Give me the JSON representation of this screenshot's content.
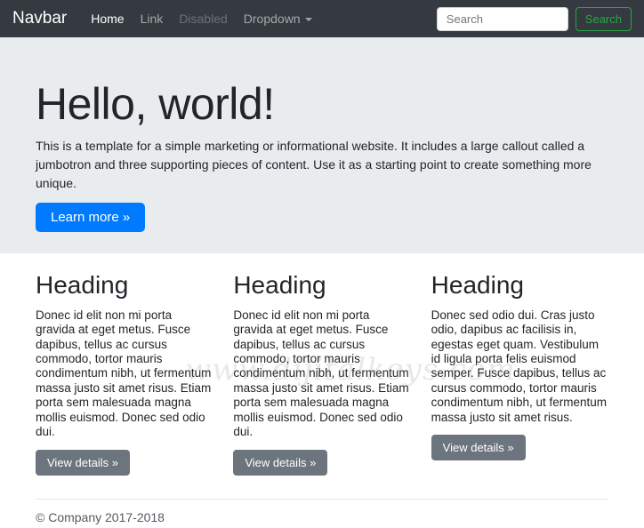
{
  "navbar": {
    "brand": "Navbar",
    "items": [
      {
        "label": "Home",
        "state": "active"
      },
      {
        "label": "Link",
        "state": "normal"
      },
      {
        "label": "Disabled",
        "state": "disabled"
      },
      {
        "label": "Dropdown",
        "state": "dropdown"
      }
    ],
    "search": {
      "placeholder": "Search",
      "value": "",
      "button_label": "Search"
    }
  },
  "jumbotron": {
    "title": "Hello, world!",
    "description": "This is a template for a simple marketing or informational website. It includes a large callout called a jumbotron and three supporting pieces of content. Use it as a starting point to create something more unique.",
    "cta_label": "Learn more »"
  },
  "columns": [
    {
      "heading": "Heading",
      "text": "Donec id elit non mi porta gravida at eget metus. Fusce dapibus, tellus ac cursus commodo, tortor mauris condimentum nibh, ut fermentum massa justo sit amet risus. Etiam porta sem malesuada magna mollis euismod. Donec sed odio dui.",
      "button_label": "View details »"
    },
    {
      "heading": "Heading",
      "text": "Donec id elit non mi porta gravida at eget metus. Fusce dapibus, tellus ac cursus commodo, tortor mauris condimentum nibh, ut fermentum massa justo sit amet risus. Etiam porta sem malesuada magna mollis euismod. Donec sed odio dui.",
      "button_label": "View details »"
    },
    {
      "heading": "Heading",
      "text": "Donec sed odio dui. Cras justo odio, dapibus ac facilisis in, egestas eget quam. Vestibulum id ligula porta felis euismod semper. Fusce dapibus, tellus ac cursus commodo, tortor mauris condimentum nibh, ut fermentum massa justo sit amet risus.",
      "button_label": "View details »"
    }
  ],
  "footer": {
    "copyright": "© Company 2017-2018"
  },
  "watermark": {
    "text": "www.dijitalkeys.com"
  },
  "colors": {
    "navbar_bg": "#343a40",
    "jumbotron_bg": "#e9ecef",
    "primary": "#007bff",
    "secondary": "#6c757d",
    "success_outline": "#28a745"
  }
}
